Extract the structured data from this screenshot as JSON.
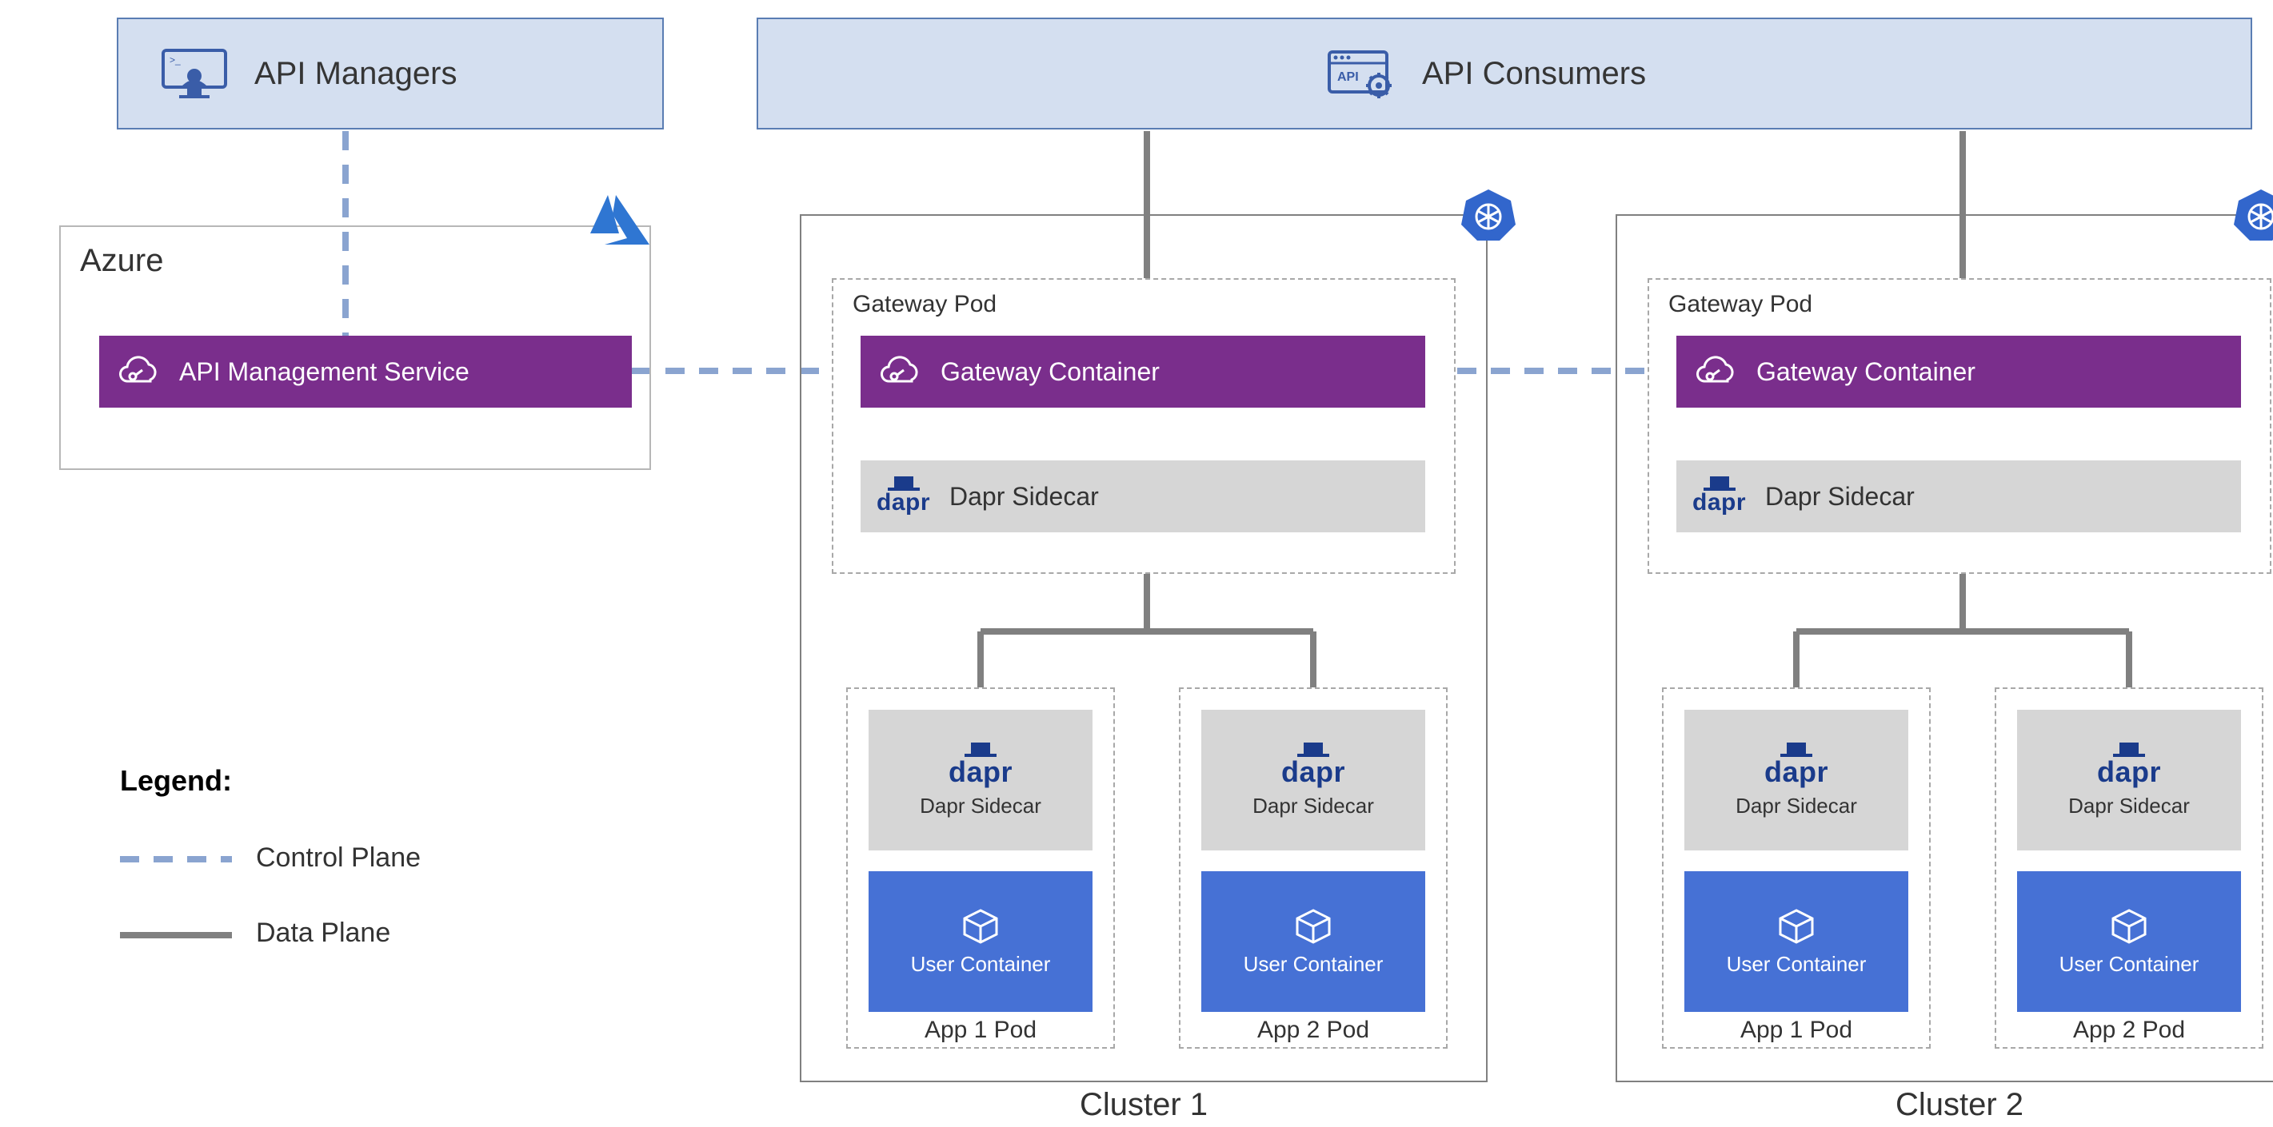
{
  "header": {
    "api_managers": "API Managers",
    "api_consumers": "API Consumers"
  },
  "azure": {
    "label": "Azure",
    "api_mgmt": "API Management Service"
  },
  "cluster1": {
    "label": "Cluster 1",
    "gateway_pod": "Gateway Pod",
    "gateway_container": "Gateway Container",
    "dapr_sidecar": "Dapr Sidecar",
    "app1": {
      "label": "App 1 Pod",
      "dapr": "Dapr Sidecar",
      "user": "User Container"
    },
    "app2": {
      "label": "App 2 Pod",
      "dapr": "Dapr Sidecar",
      "user": "User Container"
    }
  },
  "cluster2": {
    "label": "Cluster 2",
    "gateway_pod": "Gateway Pod",
    "gateway_container": "Gateway Container",
    "dapr_sidecar": "Dapr Sidecar",
    "app1": {
      "label": "App 1 Pod",
      "dapr": "Dapr Sidecar",
      "user": "User Container"
    },
    "app2": {
      "label": "App 2 Pod",
      "dapr": "Dapr Sidecar",
      "user": "User Container"
    }
  },
  "legend": {
    "title": "Legend:",
    "control": "Control Plane",
    "data": "Data Plane"
  },
  "icons": {
    "dapr": "dapr"
  }
}
